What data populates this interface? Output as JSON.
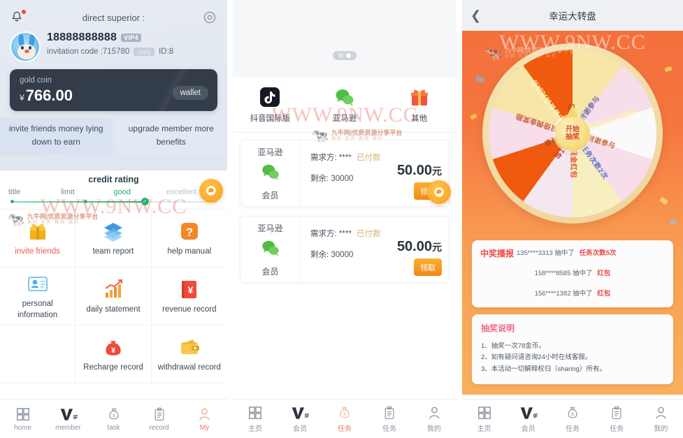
{
  "panel1": {
    "header": {
      "bell_icon": "bell-icon",
      "title": "direct superior :",
      "settings_icon": "gear-icon"
    },
    "user": {
      "avatar_icon": "rabbit-avatar",
      "phone": "18888888888",
      "vip_badge": "VIP4",
      "invitation_label": "invitation code :715780",
      "copy_label": "copy",
      "id_label": "ID:8"
    },
    "coin_card": {
      "label": "gold coin",
      "currency": "¥",
      "amount": "766.00",
      "wallet_label": "wallet"
    },
    "promos": [
      {
        "text": "invite friends money lying down to earn"
      },
      {
        "text": "upgrade member more benefits"
      }
    ],
    "credit": {
      "title": "credit rating",
      "levels": [
        "title",
        "limit",
        "good",
        "excellent"
      ]
    },
    "menu": [
      {
        "label": "invite friends",
        "icon": "gift-icon",
        "highlight": true
      },
      {
        "label": "team report",
        "icon": "layers-icon",
        "highlight": false
      },
      {
        "label": "help manual",
        "icon": "question-icon",
        "highlight": false
      },
      {
        "label": "personal information",
        "icon": "id-card-icon",
        "highlight": false
      },
      {
        "label": "daily statement",
        "icon": "bar-chart-icon",
        "highlight": false
      },
      {
        "label": "revenue record",
        "icon": "yuan-book-icon",
        "highlight": false
      },
      {
        "label": "",
        "icon": "none",
        "highlight": false
      },
      {
        "label": "Recharge record",
        "icon": "money-bag-icon",
        "highlight": false
      },
      {
        "label": "withdrawal record",
        "icon": "wallet-icon",
        "highlight": false
      }
    ],
    "tabbar": [
      {
        "label": "home",
        "icon": "grid-icon",
        "active": false
      },
      {
        "label": "member",
        "icon": "vip-icon",
        "active": false
      },
      {
        "label": "task",
        "icon": "moneybag-icon",
        "active": false
      },
      {
        "label": "record",
        "icon": "clipboard-icon",
        "active": false
      },
      {
        "label": "My",
        "icon": "person-icon",
        "active": true
      }
    ],
    "fab_icon": "customer-service-icon"
  },
  "panel2": {
    "banner": {
      "dots": 2,
      "active_dot": 2
    },
    "apps": [
      {
        "label": "抖音国际版",
        "icon": "tiktok-icon"
      },
      {
        "label": "亚马逊",
        "icon": "wechat-icon"
      },
      {
        "label": "其他",
        "icon": "gift-icon"
      }
    ],
    "tasks": [
      {
        "platform": "亚马逊",
        "platform_icon": "wechat-icon",
        "member_label": "会员",
        "demand_label": "需求方: ****",
        "paid_label": "已付款",
        "remaining_label": "剩余: 30000",
        "amount": "50.00",
        "unit": "元",
        "action_label": "领取"
      },
      {
        "platform": "亚马逊",
        "platform_icon": "wechat-icon",
        "member_label": "会员",
        "demand_label": "需求方: ****",
        "paid_label": "已付款",
        "remaining_label": "剩余: 30000",
        "amount": "50.00",
        "unit": "元",
        "action_label": "领取"
      }
    ],
    "tabbar": [
      {
        "label": "主页",
        "icon": "grid-icon",
        "active": false
      },
      {
        "label": "会员",
        "icon": "vip-icon",
        "active": false
      },
      {
        "label": "任务",
        "icon": "moneybag-icon",
        "active": true
      },
      {
        "label": "任务",
        "icon": "clipboard-icon",
        "active": false
      },
      {
        "label": "我的",
        "icon": "person-icon",
        "active": false
      }
    ],
    "fab_icon": "customer-service-icon"
  },
  "panel3": {
    "header": {
      "back_icon": "chevron-left-icon",
      "title": "幸运大转盘"
    },
    "wheel": {
      "center_line1": "开始",
      "center_line2": "抽奖",
      "segments": [
        "谢谢参与",
        "任务次数2次",
        "现金红包",
        "红包",
        "白拿",
        "双倍佣金奖励",
        "王者会员兑换券",
        "红包",
        "谢谢参与",
        "明星会员兑换券"
      ]
    },
    "winners": {
      "title": "中奖播报",
      "items": [
        {
          "phone": "135****3313",
          "verb": "抽中了",
          "prize": "任务次数5次"
        },
        {
          "phone": "158****8585",
          "verb": "抽中了",
          "prize": "红包"
        },
        {
          "phone": "156****1382",
          "verb": "抽中了",
          "prize": "红包"
        }
      ]
    },
    "rules": {
      "title": "抽奖说明",
      "items": [
        "1、抽奖一次78金币。",
        "2、如有疑问请咨询24小时在线客服。",
        "3、本活动一切解释权归（sharing）所有。"
      ]
    },
    "tabbar": [
      {
        "label": "主页",
        "icon": "grid-icon",
        "active": false
      },
      {
        "label": "会员",
        "icon": "vip-icon",
        "active": false
      },
      {
        "label": "任务",
        "icon": "moneybag-icon",
        "active": false
      },
      {
        "label": "任务",
        "icon": "clipboard-icon",
        "active": false
      },
      {
        "label": "我的",
        "icon": "person-icon",
        "active": false
      }
    ]
  },
  "watermark": {
    "url": "WWW.9NW.CC",
    "cow_brand": "九牛网|优质资源分享平台",
    "cow_sub": "源码 软件 教程 福利"
  },
  "colors": {
    "accent_orange": "#f5a020",
    "accent_red": "#ef4a4a",
    "coin_card": "#333c49",
    "good_green": "#22b06b",
    "tab_active": "#f2796b"
  }
}
